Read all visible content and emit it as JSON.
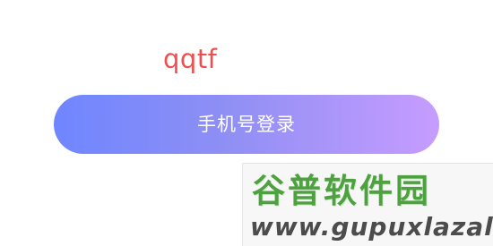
{
  "app": {
    "name": "qqtf"
  },
  "actions": {
    "phone_login_label": "手机号登录"
  },
  "watermark": {
    "brand": "谷普软件园",
    "url": "www.gupuxlazal.com"
  },
  "colors": {
    "app_name": "#ef4f4f",
    "button_gradient_start": "#6f86ff",
    "button_gradient_end": "#c79cff",
    "button_text": "#ffffff",
    "watermark_green": "#4ea13f",
    "watermark_gray": "#4c4c4c"
  }
}
